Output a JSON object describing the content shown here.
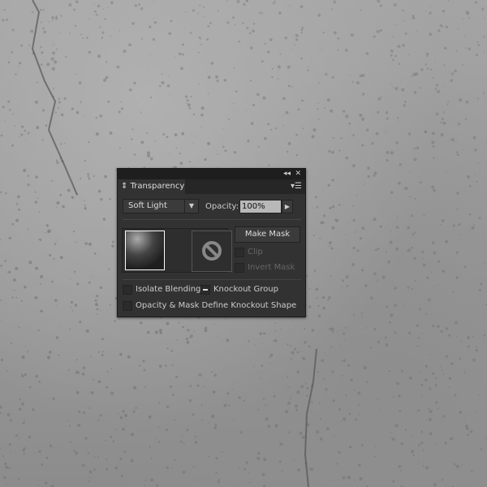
{
  "panel": {
    "title": "Transparency",
    "blend_mode": "Soft Light",
    "opacity_label": "Opacity:",
    "opacity_value": "100%",
    "make_mask": "Make Mask",
    "clip": "Clip",
    "invert_mask": "Invert Mask",
    "isolate_blending": "Isolate Blending",
    "knockout_group": "Knockout Group",
    "opacity_mask_knockout": "Opacity & Mask Define Knockout Shape",
    "clip_checked": false,
    "invert_checked": false,
    "isolate_checked": false,
    "knockout_state": "mixed",
    "opacity_knockout_checked": false
  },
  "icons": {
    "collapse": "double-chevron-left-icon",
    "close": "close-icon",
    "menu": "panel-menu-icon",
    "mask": "no-mask-icon"
  }
}
